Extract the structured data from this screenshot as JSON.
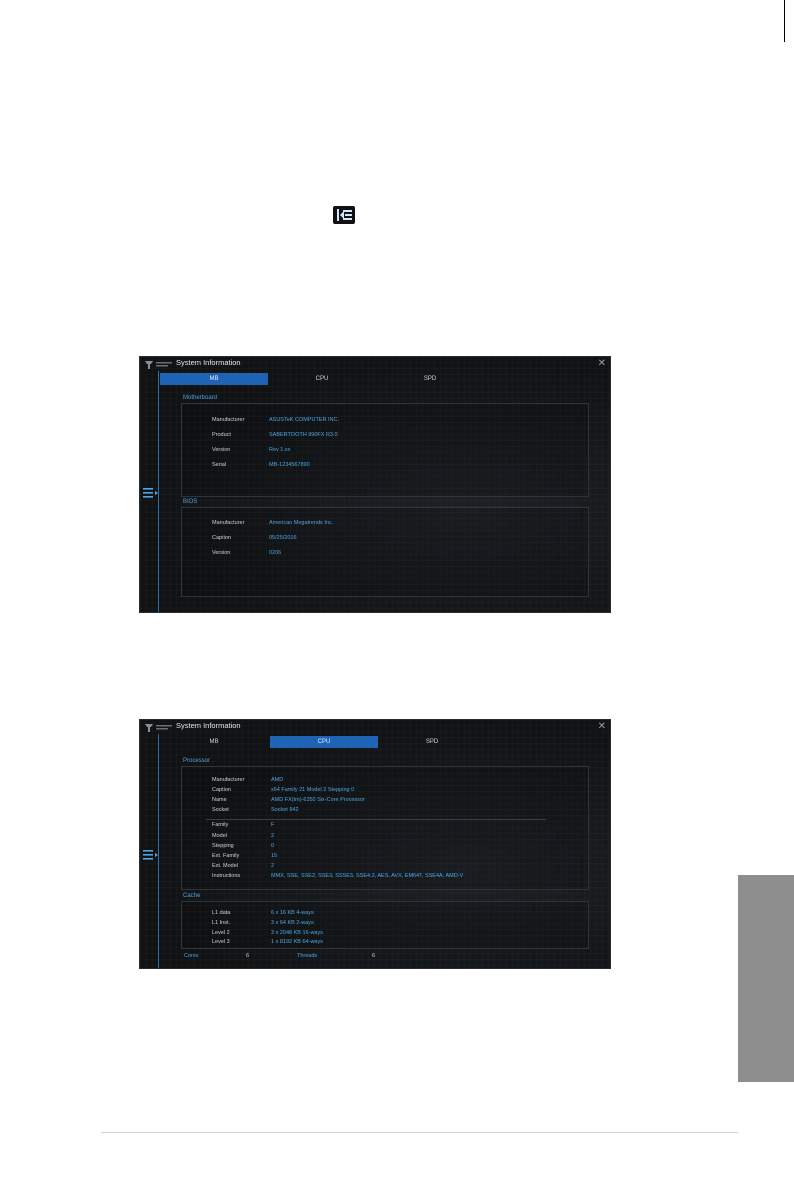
{
  "colors": {
    "accent": "#1f63b5",
    "value_text": "#4fa6e6",
    "section_title": "#4fa3e0",
    "side_tab": "#8e8e8e"
  },
  "inline_icon": "menu-collapse-icon",
  "screens": {
    "mb": {
      "window_title": "System Information",
      "tabs": [
        "MB",
        "CPU",
        "SPD"
      ],
      "active_tab": "MB",
      "motherboard": {
        "title": "Motherboard",
        "rows": [
          {
            "label": "Manufacturer",
            "value": "ASUSTeK COMPUTER INC."
          },
          {
            "label": "Product",
            "value": "SABERTOOTH 990FX R3.0"
          },
          {
            "label": "Version",
            "value": "Rev 1.xx"
          },
          {
            "label": "Serial",
            "value": "MB-1234567890"
          }
        ]
      },
      "bios": {
        "title": "BIOS",
        "rows": [
          {
            "label": "Manufacturer",
            "value": "American Megatrends Inc."
          },
          {
            "label": "Caption",
            "value": "05/25/2016"
          },
          {
            "label": "Version",
            "value": "0206"
          }
        ]
      }
    },
    "cpu": {
      "window_title": "System Information",
      "tabs": [
        "MB",
        "CPU",
        "SPD"
      ],
      "active_tab": "CPU",
      "processor": {
        "title": "Processor",
        "rows_top": [
          {
            "label": "Manufacturer",
            "value": "AMD"
          },
          {
            "label": "Caption",
            "value": "x64 Family 21 Model 2 Stepping 0"
          },
          {
            "label": "Name",
            "value": "AMD FX(tm)-6350 Six-Core Processor"
          },
          {
            "label": "Socket",
            "value": "Socket 942"
          }
        ],
        "rows_bottom": [
          {
            "label": "Family",
            "value": "F"
          },
          {
            "label": "Model",
            "value": "2"
          },
          {
            "label": "Stepping",
            "value": "0"
          },
          {
            "label": "Ext. Family",
            "value": "15"
          },
          {
            "label": "Ext. Model",
            "value": "2"
          },
          {
            "label": "Instructions",
            "value": "MMX, SSE, SSE2, SSE3, SSSE3, SSE4.2, AES, AVX, EM64T, SSE4A, AMD-V"
          }
        ]
      },
      "cache": {
        "title": "Cache",
        "rows": [
          {
            "label": "L1 data",
            "value": "6 x 16 KB 4-ways"
          },
          {
            "label": "L1 Inst.",
            "value": "3 x 64 KB 2-ways"
          },
          {
            "label": "Level 2",
            "value": "3 x 2048 KB 16-ways"
          },
          {
            "label": "Level 3",
            "value": "1 x 8192 KB 64-ways"
          }
        ]
      },
      "footer": {
        "cores_label": "Cores",
        "cores_value": "6",
        "threads_label": "Threads",
        "threads_value": "6"
      }
    }
  }
}
